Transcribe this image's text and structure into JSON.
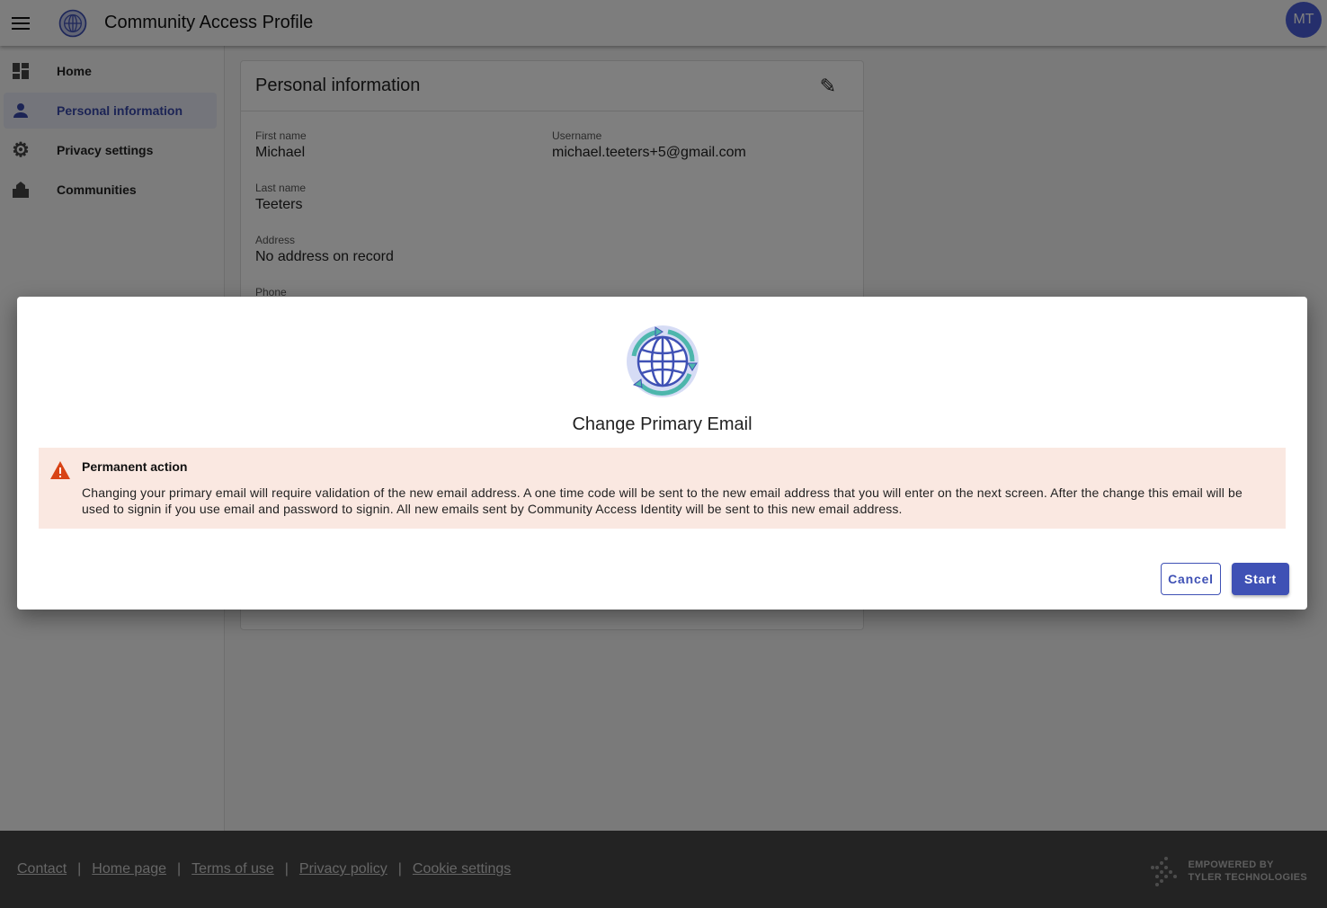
{
  "header": {
    "title": "Community Access Profile",
    "avatar_initials": "MT"
  },
  "sidebar": {
    "items": [
      {
        "label": "Home",
        "icon": "dashboard-icon"
      },
      {
        "label": "Personal information",
        "icon": "person-icon",
        "active": true
      },
      {
        "label": "Privacy settings",
        "icon": "gear-icon"
      },
      {
        "label": "Communities",
        "icon": "city-icon"
      }
    ]
  },
  "card": {
    "title": "Personal information",
    "fields": {
      "first_name": {
        "label": "First name",
        "value": "Michael"
      },
      "username": {
        "label": "Username",
        "value": "michael.teeters+5@gmail.com"
      },
      "last_name": {
        "label": "Last name",
        "value": "Teeters"
      },
      "address": {
        "label": "Address",
        "value": "No address on record"
      },
      "phone": {
        "label": "Phone"
      }
    }
  },
  "dialog": {
    "title": "Change Primary Email",
    "warning_title": "Permanent action",
    "warning_body": "Changing your primary email will require validation of the new email address. A one time code will be sent to the new email address that you will enter on the next screen. After the change this email will be used to signin if you use email and password to signin. All new emails sent by Community Access Identity will be sent to this new email address.",
    "cancel": "Cancel",
    "start": "Start"
  },
  "footer": {
    "links": [
      "Contact",
      "Home page",
      "Terms of use",
      "Privacy policy",
      "Cookie settings"
    ],
    "brand_line1": "EMPOWERED BY",
    "brand_line2": "TYLER TECHNOLOGIES"
  },
  "colors": {
    "primary": "#3f51b5",
    "warning_bg": "#fae8e1",
    "warning_icon": "#d84315"
  }
}
